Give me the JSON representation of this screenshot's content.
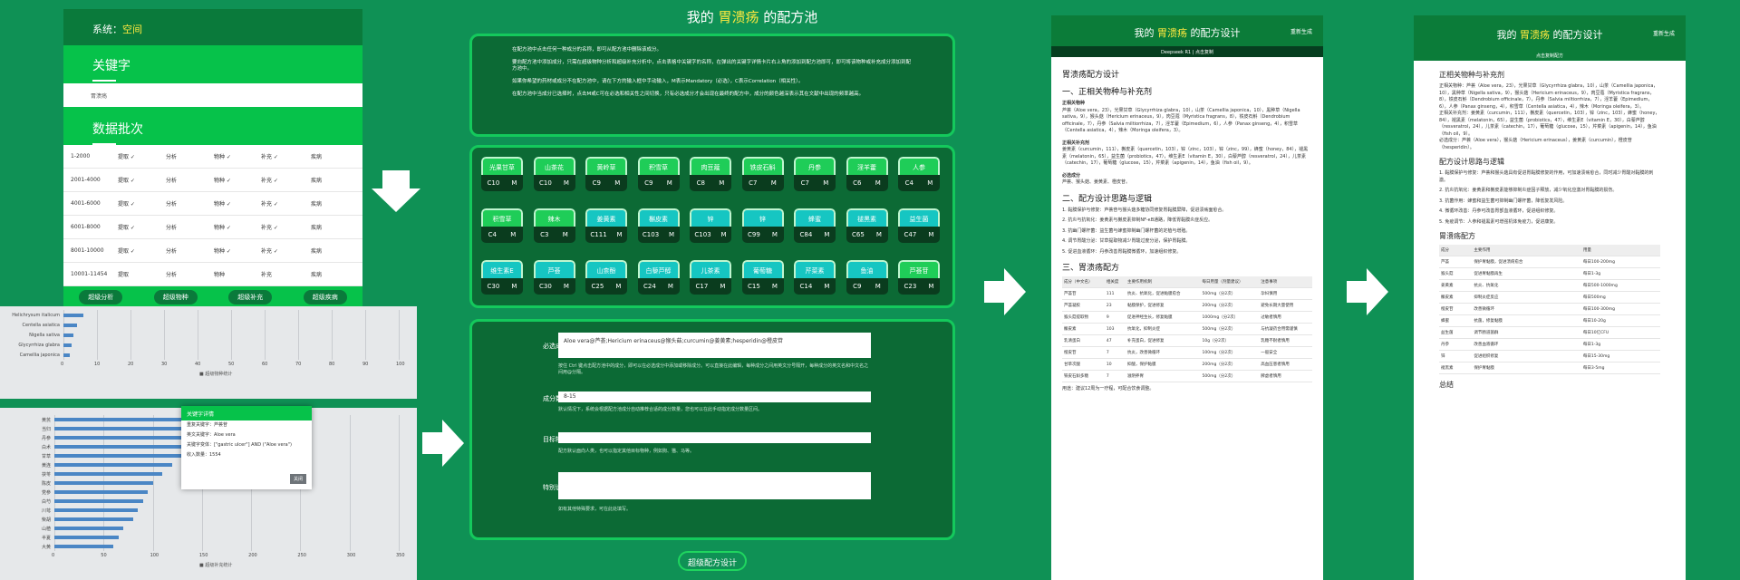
{
  "panelA": {
    "system_label": "系统：",
    "system_value": "空间",
    "keyword_header": "关键字",
    "keyword_value": "胃溃疡",
    "data_header": "数据批次",
    "rows": [
      [
        "1-2000",
        "提取 ✓",
        "分析",
        "物种 ✓",
        "补充 ✓",
        "疾病"
      ],
      [
        "2001-4000",
        "提取 ✓",
        "分析",
        "物种 ✓",
        "补充 ✓",
        "疾病"
      ],
      [
        "4001-6000",
        "提取 ✓",
        "分析",
        "物种 ✓",
        "补充 ✓",
        "疾病"
      ],
      [
        "6001-8000",
        "提取 ✓",
        "分析",
        "物种 ✓",
        "补充 ✓",
        "疾病"
      ],
      [
        "8001-10000",
        "提取 ✓",
        "分析",
        "物种 ✓",
        "补充 ✓",
        "疾病"
      ],
      [
        "10001-11454",
        "提取",
        "分析",
        "物种",
        "补充",
        "疾病"
      ]
    ],
    "buttons": [
      "超级分析",
      "超级物种",
      "超级补充",
      "超级疾病"
    ]
  },
  "chartTop": {
    "labels": [
      "Helichrysum italicum",
      "Centella asiatica",
      "Nigella sativa",
      "Glycyrrhiza glabra",
      "Camellia japonica"
    ],
    "values": [
      6,
      4,
      3,
      2.5,
      2
    ],
    "ticks": [
      "0",
      "10",
      "20",
      "30",
      "40",
      "50",
      "60",
      "70",
      "80",
      "90",
      "100"
    ],
    "legend": "超级物种统计"
  },
  "chartBottom": {
    "labels": [
      "黄芪",
      "当归",
      "丹参",
      "白术",
      "甘草",
      "黄连",
      "茯苓",
      "陈皮",
      "党参",
      "白芍",
      "川芎",
      "柴胡",
      "山楂",
      "半夏",
      "大黄"
    ],
    "values": [
      220,
      180,
      160,
      140,
      130,
      120,
      110,
      100,
      95,
      90,
      85,
      80,
      70,
      65,
      60
    ],
    "ticks": [
      "0",
      "50",
      "100",
      "150",
      "200",
      "250",
      "300",
      "350"
    ],
    "legend": "超级补充统计"
  },
  "modal": {
    "title": "关键字详情",
    "lines": [
      "重复关键字：芦荟苷",
      "英文关键字：Aloe vera",
      "关键字变体：[\"gastric ulcer\"] AND (\"Aloe vera\")",
      "收入数量：1554"
    ],
    "close": "关闭"
  },
  "poolTitle": {
    "pre": "我的",
    "kw": "胃溃疡",
    "post": "的配方池"
  },
  "intro": [
    "在配方池中点击任何一种成分的名称，即可从配方池中删除该成分。",
    "要向配方池中添加成分，只需在超级物种分析和超级补充分析中，点击表格中关键字的名称，在弹出的关键字详情卡片右上角的添加到配方池即可，即可将该物种或补充成分添加到配方池中。",
    "如果你希望的药材或成分不在配方池中，请在下方的输入框中手动输入，M表示Mandatory（必选），C表示Correlation（相关性）。",
    "在配方池中当成分已选择时，点击M或C可在必选和相关性之间切换，只有必选成分才会出现在最终的配方中，成分的颜色越深表示其在文献中出现的频率越高。"
  ],
  "herbs": [
    [
      "光果甘草",
      "C10",
      "M",
      "g"
    ],
    [
      "山茶花",
      "C10",
      "M",
      "g"
    ],
    [
      "黄岭草",
      "C9",
      "M",
      "g"
    ],
    [
      "积雪草",
      "C9",
      "M",
      "g"
    ],
    [
      "肉豆蔻",
      "C8",
      "M",
      "g"
    ],
    [
      "铁皮石斛",
      "C7",
      "M",
      "g"
    ],
    [
      "丹参",
      "C7",
      "M",
      "g"
    ],
    [
      "淫羊藿",
      "C6",
      "M",
      "g"
    ],
    [
      "人参",
      "C4",
      "M",
      "g"
    ],
    [
      "积雪草",
      "C4",
      "M",
      "g"
    ],
    [
      "辣木",
      "C3",
      "M",
      "g"
    ],
    [
      "姜黄素",
      "C111",
      "M",
      "c"
    ],
    [
      "槲皮素",
      "C103",
      "M",
      "c"
    ],
    [
      "锌",
      "C103",
      "M",
      "c"
    ],
    [
      "锌",
      "C99",
      "M",
      "c"
    ],
    [
      "蜂蜜",
      "C84",
      "M",
      "c"
    ],
    [
      "褪黑素",
      "C65",
      "M",
      "c"
    ],
    [
      "益生菌",
      "C47",
      "M",
      "c"
    ],
    [
      "维生素E",
      "C30",
      "M",
      "c"
    ],
    [
      "芦荟",
      "C30",
      "M",
      "c"
    ],
    [
      "山柰酚",
      "C25",
      "M",
      "c"
    ],
    [
      "白藜芦醇",
      "C24",
      "M",
      "c"
    ],
    [
      "儿茶素",
      "C17",
      "M",
      "c"
    ],
    [
      "葡萄糖",
      "C15",
      "M",
      "c"
    ],
    [
      "芹菜素",
      "C14",
      "M",
      "c"
    ],
    [
      "鱼油",
      "C9",
      "M",
      "c"
    ],
    [
      "芦荟苷",
      "C23",
      "M",
      "g"
    ]
  ],
  "form": {
    "must_label": "必选成分",
    "must_value": "Aloe vera@芦荟;Hericium erinaceus@猴头菇;curcumin@姜黄素;hesperidin@橙皮苷",
    "must_help": "按住 Ctrl 键点击配方池中的成分，即可以在必选成分中添加或移除成分。可以直接在此编辑，每种成分之间用英文分号隔开，每种成分的英文名和中文名之间用@分隔。",
    "count_label": "成分数量",
    "count_value": "8-15",
    "count_help": "默认情况下，系统会根据配方池成分自动推荐合适的成分数量，您也可以在此手动指定成分数量区间。",
    "target_label": "目标物种",
    "target_value": "",
    "target_help": "配方默认面向人类，也可以指定其他目标物种，例如狗、猫、马等。",
    "notes_label": "特别说明",
    "notes_value": "",
    "notes_help": "如有其他特殊要求，可在此处填写。",
    "submit": "超级配方设计"
  },
  "doc1": {
    "title_pre": "我的",
    "title_kw": "胃溃疡",
    "title_post": "的配方设计",
    "top_right": "重新生成",
    "sub": "Deepseek R1 | 点击复制",
    "h_main": "胃溃疡配方设计",
    "h1": "一、正相关物种与补充剂",
    "s1": "正相关物种",
    "p1": "芦荟（Aloe vera，23），光果甘草（Glycyrrhiza glabra，10），山茶（Camellia japonica，10），黑种草（Nigella sativa，9），猴头菇（Hericium erinaceus，9），肉豆蔻（Myristica fragrans，8），铁皮石斛（Dendrobium officinale，7），丹参（Salvia miltiorrhiza，7），淫羊藿（Epimedium，6），人参（Panax ginseng，4），积雪草（Centella asiatica，4），辣木（Moringa oleifera，3）。",
    "s2": "正相关补充剂",
    "p2": "姜黄素（curcumin，111），槲皮素（quercetin，103），锌（zinc，103），锌（zinc，99），蜂蜜（honey，84），褪黑素（melatonin，65），益生菌（probiotics，47），维生素E（vitamin E，30），白藜芦醇（resveratrol，24），儿茶素（catechin，17），葡萄糖（glucose，15），芹菜素（apigenin，14），鱼油（fish oil，9）。",
    "s3": "必选成分",
    "p3": "芦荟、猴头菇、姜黄素、橙皮苷。",
    "h2": "二、配方设计思路与逻辑",
    "steps": [
      "1. 黏膜保护与修复：芦荟苷与猴头菇多糖协同修复胃黏膜屏障，促进溃疡面愈合。",
      "2. 抗炎与抗氧化：姜黄素与槲皮素抑制NF-κB通路，降低胃黏膜炎症反应。",
      "3. 抗幽门螺杆菌：益生菌与蜂蜜抑制幽门螺杆菌的定植与增殖。",
      "4. 调节胃酸分泌：甘草提取物减少胃酸过度分泌，保护胃黏膜。",
      "5. 促进血液循环：丹参改善胃黏膜微循环，加速组织修复。"
    ],
    "h3": "三、胃溃疡配方",
    "cols": [
      "成分（中文名）",
      "相关度",
      "主要作用机制",
      "每日用量（剂量建议）",
      "注意事项"
    ],
    "rows": [
      [
        "芦荟苷",
        "111",
        "抗炎、抗氧化，促进黏膜愈合",
        "500mg（分2次）",
        "孕妇慎用"
      ],
      [
        "芦荟凝胶",
        "23",
        "黏膜保护，促进修复",
        "200mg（分2次）",
        "避免长期大量使用"
      ],
      [
        "猴头菇提取物",
        "9",
        "促进神经生长，修复黏膜",
        "1000mg（分2次）",
        "过敏者慎用"
      ],
      [
        "槲皮素",
        "103",
        "抗氧化，抑制炎症",
        "500mg（分2次）",
        "与抗凝药合用需谨慎"
      ],
      [
        "乳清蛋白",
        "47",
        "补充蛋白，促进修复",
        "10g（分2次）",
        "乳糖不耐者慎用"
      ],
      [
        "橙皮苷",
        "7",
        "抗炎，改善微循环",
        "100mg（分2次）",
        "一般安全"
      ],
      [
        "甘草次酸",
        "10",
        "抑酸，保护黏膜",
        "200mg（分2次）",
        "高血压患者慎用"
      ],
      [
        "铁皮石斛多糖",
        "7",
        "滋阴养胃",
        "500mg（分2次）",
        "脾虚者慎用"
      ]
    ],
    "foot": "用途：建议12周为一疗程，可配合饮食调整。"
  },
  "doc2": {
    "title_pre": "我的",
    "title_kw": "胃溃疡",
    "title_post": "的配方设计",
    "top_right": "重新生成",
    "sub": "点击复制配方",
    "h1": "正相关物种与补充剂",
    "p1": "正相关物种：芦荟（Aloe vera，23），光果甘草（Glycyrrhiza glabra，10），山茶（Camellia japonica，10），黑种草（Nigella sativa，9），猴头菇（Hericium erinaceus，9），肉豆蔻（Myristica fragrans，8），铁皮石斛（Dendrobium officinale，7），丹参（Salvia miltiorrhiza，7），淫羊藿（Epimedium，6），人参（Panax ginseng，4），积雪草（Centella asiatica，4），辣木（Moringa oleifera，3）。",
    "p2": "正相关补充剂：姜黄素（curcumin，111），槲皮素（quercetin，103），锌（zinc，103），蜂蜜（honey，84），褪黑素（melatonin，65），益生菌（probiotics，47），维生素E（vitamin E，30），白藜芦醇（resveratrol，24），儿茶素（catechin，17），葡萄糖（glucose，15），芹菜素（apigenin，14），鱼油（fish oil，9）。",
    "p3": "必选成分：芦荟（Aloe vera），猴头菇（Hericium erinaceus），姜黄素（curcumin），橙皮苷（hesperidin）。",
    "h2": "配方设计思路与逻辑",
    "steps": [
      "1. 黏膜保护与修复：芦荟和猴头菇具有促进胃黏膜修复的作用，可加速溃疡愈合，同时减少胃酸对黏膜的刺激。",
      "2. 抗炎抗氧化：姜黄素和槲皮素能够抑制炎症因子释放，减少氧化应激对胃黏膜的损伤。",
      "3. 抗菌作用：蜂蜜和益生菌可抑制幽门螺杆菌，降低复发风险。",
      "4. 微循环改善：丹参可改善胃部血液循环，促进组织修复。",
      "5. 免疫调节：人参和褪黑素可增强机体免疫力，促进康复。"
    ],
    "h3": "胃溃疡配方",
    "cols": [
      "成分",
      "主要作用",
      "用量"
    ],
    "rows": [
      [
        "芦荟",
        "保护胃黏膜，促进溃疡愈合",
        "每日100-200mg"
      ],
      [
        "猴头菇",
        "促进胃黏膜再生",
        "每日1-3g"
      ],
      [
        "姜黄素",
        "抗炎、抗氧化",
        "每日500-1000mg"
      ],
      [
        "槲皮素",
        "抑制炎症反应",
        "每日500mg"
      ],
      [
        "橙皮苷",
        "改善微循环",
        "每日100-300mg"
      ],
      [
        "蜂蜜",
        "抗菌，修复黏膜",
        "每日10-20g"
      ],
      [
        "益生菌",
        "调节肠道菌群",
        "每日10亿CFU"
      ],
      [
        "丹参",
        "改善血液循环",
        "每日1-3g"
      ],
      [
        "锌",
        "促进组织修复",
        "每日15-30mg"
      ],
      [
        "褪黑素",
        "保护胃黏膜",
        "每日3-5mg"
      ]
    ],
    "h4": "总结"
  }
}
